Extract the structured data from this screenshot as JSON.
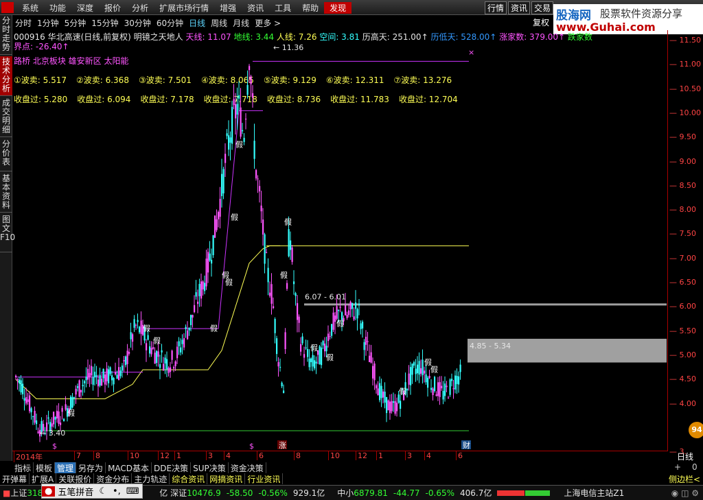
{
  "menu": {
    "logo": "",
    "items": [
      "系统",
      "功能",
      "深度",
      "报价",
      "分析",
      "扩展市场行情",
      "增强",
      "资讯",
      "工具",
      "帮助"
    ],
    "hot": "发现"
  },
  "right_tabs": [
    "行情",
    "资讯",
    "交易"
  ],
  "brand": {
    "name": "股海网",
    "slogan": "股票软件资源分享",
    "url": "www.Guhai.com"
  },
  "sidebar": [
    "分时走势",
    "技术分析",
    "成交明细",
    "分价表",
    "基本资料",
    "图文F10"
  ],
  "periods": [
    "分时",
    "1分钟",
    "5分钟",
    "15分钟",
    "30分钟",
    "60分钟",
    "日线",
    "周线",
    "月线",
    "更多 >"
  ],
  "active_period": "日线",
  "restore_label": "复权",
  "info": {
    "code": "000916 华北高速(日线,前复权) 明镜之天地人",
    "tian": "天线: 11.07",
    "di": "地线: 3.44",
    "ren": "人线: 7.26",
    "kong": "空间: 3.81",
    "high": "历高天: 251.00↑",
    "low": "历低天: 528.00↑",
    "zhang": "涨家数: 379.00↑",
    "extra": "跌家数",
    "jiedian": "界点: -26.40↑"
  },
  "sectors": "路桥 北京板块 雄安新区 太阳能",
  "wave_sell": [
    "①波卖: 5.517",
    "②波卖: 6.368",
    "③波卖: 7.501",
    "④波卖: 8.065",
    "⑤波卖: 9.129",
    "⑥波卖: 12.311",
    "⑦波卖: 13.276"
  ],
  "close_over": [
    "收盘过: 5.280",
    "收盘过: 6.094",
    "收盘过: 7.178",
    "收盘过: 7.718",
    "收盘过: 8.736",
    "收盘过: 11.783",
    "收盘过: 12.704"
  ],
  "annotations": {
    "top": "11.36",
    "bottom": "3.40",
    "zone1": "6.07 - 6.01",
    "zone2": "4.85 - 5.34",
    "fake": "假",
    "zhang": "涨",
    "cai": "财",
    "dollar": "$"
  },
  "y_ticks": [
    "11.50",
    "11.00",
    "10.50",
    "10.00",
    "9.50",
    "9.00",
    "8.50",
    "8.00",
    "7.50",
    "7.00",
    "6.50",
    "6.00",
    "5.50",
    "5.00",
    "4.50",
    "4.00",
    "3."
  ],
  "x_labels": [
    "2014年",
    "7",
    "8",
    "10",
    "12",
    "1",
    "3",
    "4",
    "6",
    "8",
    "10",
    "12",
    "1",
    "3",
    "4",
    "6"
  ],
  "day_label": "日线",
  "right_small": [
    "+",
    "0"
  ],
  "toolbar1": [
    "指标",
    "模板",
    "管理",
    "另存为",
    "MACD基本",
    "DDE决策",
    "SUP决策",
    "资金决策"
  ],
  "toolbar2": [
    "开弹幕",
    "扩展A",
    "关联报价",
    "资金分布",
    "主力轨迹",
    "综合资讯",
    "网摘资讯",
    "行业资讯"
  ],
  "sidebar_col": "侧边栏<",
  "ime": [
    "五笔拼音"
  ],
  "status": {
    "sh_name": "上证",
    "sh_val": "318",
    "sz_label": "亿 深证",
    "sz_val": "10476.9",
    "sz_chg": "-58.50",
    "sz_pct": "-0.56%",
    "sz_amt": "929.1亿",
    "zx_name": "中小",
    "zx_val": "6879.81",
    "zx_chg": "-44.77",
    "zx_pct": "-0.65%",
    "zx_amt": "406.7亿",
    "station": "上海电信主站Z1"
  },
  "badge": "94",
  "colors": {
    "up": "#ff55ff",
    "down": "#33ffff",
    "yellow": "#ffff55",
    "green": "#33cc33",
    "purple": "#cc33ff",
    "gray": "#a0a0a0"
  },
  "chart_data": {
    "type": "candlestick",
    "ylim": [
      3.2,
      11.6
    ],
    "close_path": [
      4.55,
      4.4,
      4.1,
      3.8,
      3.5,
      3.45,
      3.6,
      3.7,
      3.75,
      3.9,
      4.1,
      4.3,
      4.45,
      4.55,
      4.6,
      4.5,
      4.55,
      4.6,
      4.65,
      4.7,
      5.2,
      5.6,
      5.5,
      5.3,
      5.1,
      5.0,
      4.9,
      4.85,
      4.95,
      5.2,
      5.5,
      5.8,
      6.2,
      6.5,
      7.0,
      7.6,
      8.3,
      9.2,
      9.8,
      10.2,
      9.5,
      11.36,
      9.0,
      8.0,
      6.8,
      6.2,
      5.0,
      4.3,
      7.7,
      6.2,
      5.3,
      5.0,
      4.8,
      4.9,
      5.1,
      5.5,
      5.7,
      5.9,
      5.8,
      5.9,
      6.0,
      5.4,
      5.0,
      4.6,
      4.2,
      4.0,
      3.9,
      4.0,
      4.2,
      4.5,
      4.7,
      4.8,
      4.6,
      4.4,
      4.3,
      4.2,
      4.3,
      4.5,
      4.6
    ]
  }
}
